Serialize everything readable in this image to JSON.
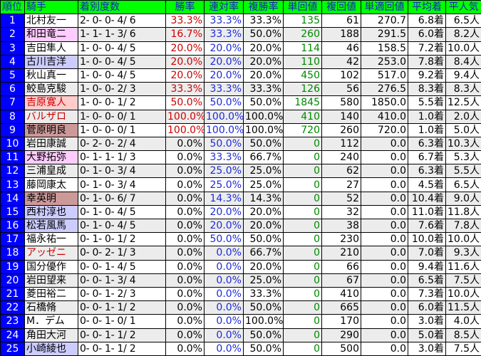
{
  "headers": [
    "順位",
    "騎手",
    "着別度数",
    "勝率",
    "連対率",
    "複勝率",
    "単回値",
    "複回値",
    "単適回値",
    "平均着",
    "平人気"
  ],
  "rows": [
    {
      "rank": "1",
      "name": "北村友一",
      "record": "2- 0- 0- 4/ 6",
      "win": "33.3%",
      "quin": "33.3%",
      "show": "33.3%",
      "tan": "135",
      "fuku": "61",
      "tekio": "270.7",
      "avg": "6.8着",
      "pop": "6.5人",
      "hl": ""
    },
    {
      "rank": "2",
      "name": "和田竜二",
      "record": "1- 1- 1- 3/ 6",
      "win": "16.7%",
      "quin": "33.3%",
      "show": "50.0%",
      "tan": "260",
      "fuku": "188",
      "tekio": "291.5",
      "avg": "6.0着",
      "pop": "8.2人",
      "hl": "pink"
    },
    {
      "rank": "3",
      "name": "吉田隼人",
      "record": "1- 0- 0- 4/ 5",
      "win": "20.0%",
      "quin": "20.0%",
      "show": "20.0%",
      "tan": "114",
      "fuku": "46",
      "tekio": "158.5",
      "avg": "7.2着",
      "pop": "10.0人",
      "hl": ""
    },
    {
      "rank": "4",
      "name": "古川吉洋",
      "record": "1- 0- 0- 4/ 5",
      "win": "20.0%",
      "quin": "20.0%",
      "show": "20.0%",
      "tan": "110",
      "fuku": "42",
      "tekio": "253.0",
      "avg": "7.8着",
      "pop": "8.4人",
      "hl": "lav"
    },
    {
      "rank": "5",
      "name": "秋山真一",
      "record": "1- 0- 0- 4/ 5",
      "win": "20.0%",
      "quin": "20.0%",
      "show": "20.0%",
      "tan": "450",
      "fuku": "102",
      "tekio": "517.0",
      "avg": "9.2着",
      "pop": "9.4人",
      "hl": ""
    },
    {
      "rank": "6",
      "name": "鮫島克駿",
      "record": "1- 0- 0- 2/ 3",
      "win": "33.3%",
      "quin": "33.3%",
      "show": "33.3%",
      "tan": "126",
      "fuku": "56",
      "tekio": "276.5",
      "avg": "8.3着",
      "pop": "8.3人",
      "hl": ""
    },
    {
      "rank": "7",
      "name": "吉原寛人",
      "record": "1- 0- 0- 1/ 2",
      "win": "50.0%",
      "quin": "50.0%",
      "show": "50.0%",
      "tan": "1845",
      "fuku": "580",
      "tekio": "1850.0",
      "avg": "5.5着",
      "pop": "12.5人",
      "hl": "salmon",
      "redname": true
    },
    {
      "rank": "8",
      "name": "バルザロ",
      "record": "1- 0- 0- 0/ 1",
      "win": "100.0%",
      "quin": "100.0%",
      "show": "100.0%",
      "tan": "410",
      "fuku": "140",
      "tekio": "410.0",
      "avg": "1.0着",
      "pop": "2.0人",
      "hl": "",
      "redname": true
    },
    {
      "rank": "9",
      "name": "菅原明良",
      "record": "1- 0- 0- 0/ 1",
      "win": "100.0%",
      "quin": "100.0%",
      "show": "100.0%",
      "tan": "720",
      "fuku": "260",
      "tekio": "720.0",
      "avg": "1.0着",
      "pop": "5.0人",
      "hl": "rose"
    },
    {
      "rank": "10",
      "name": "岩田康誠",
      "record": "0- 2- 0- 2/ 4",
      "win": "0.0%",
      "quin": "50.0%",
      "show": "50.0%",
      "tan": "0",
      "fuku": "112",
      "tekio": "0.0",
      "avg": "6.3着",
      "pop": "10.3人",
      "hl": ""
    },
    {
      "rank": "11",
      "name": "大野拓弥",
      "record": "0- 1- 1- 1/ 3",
      "win": "0.0%",
      "quin": "33.3%",
      "show": "66.7%",
      "tan": "0",
      "fuku": "240",
      "tekio": "0.0",
      "avg": "6.7着",
      "pop": "5.3人",
      "hl": "pink"
    },
    {
      "rank": "12",
      "name": "三浦皇成",
      "record": "0- 1- 0- 3/ 4",
      "win": "0.0%",
      "quin": "25.0%",
      "show": "25.0%",
      "tan": "0",
      "fuku": "62",
      "tekio": "0.0",
      "avg": "6.3着",
      "pop": "5.5人",
      "hl": ""
    },
    {
      "rank": "13",
      "name": "藤岡康太",
      "record": "0- 1- 0- 3/ 4",
      "win": "0.0%",
      "quin": "25.0%",
      "show": "25.0%",
      "tan": "0",
      "fuku": "27",
      "tekio": "0.0",
      "avg": "4.5着",
      "pop": "6.5人",
      "hl": ""
    },
    {
      "rank": "14",
      "name": "幸英明",
      "record": "0- 1- 0- 6/ 7",
      "win": "0.0%",
      "quin": "14.3%",
      "show": "14.3%",
      "tan": "0",
      "fuku": "52",
      "tekio": "0.0",
      "avg": "10.4着",
      "pop": "9.0人",
      "hl": "rose"
    },
    {
      "rank": "15",
      "name": "西村淳也",
      "record": "0- 1- 0- 4/ 5",
      "win": "0.0%",
      "quin": "20.0%",
      "show": "20.0%",
      "tan": "0",
      "fuku": "32",
      "tekio": "0.0",
      "avg": "11.0着",
      "pop": "11.8人",
      "hl": "lav"
    },
    {
      "rank": "16",
      "name": "松若風馬",
      "record": "0- 1- 0- 4/ 5",
      "win": "0.0%",
      "quin": "20.0%",
      "show": "20.0%",
      "tan": "0",
      "fuku": "38",
      "tekio": "0.0",
      "avg": "7.6着",
      "pop": "7.8人",
      "hl": "lav"
    },
    {
      "rank": "17",
      "name": "福永祐一",
      "record": "0- 1- 0- 1/ 2",
      "win": "0.0%",
      "quin": "50.0%",
      "show": "50.0%",
      "tan": "0",
      "fuku": "230",
      "tekio": "0.0",
      "avg": "10.0着",
      "pop": "10.0人",
      "hl": ""
    },
    {
      "rank": "18",
      "name": "アッゼニ",
      "record": "0- 0- 2- 1/ 3",
      "win": "0.0%",
      "quin": "0.0%",
      "show": "66.7%",
      "tan": "0",
      "fuku": "210",
      "tekio": "0.0",
      "avg": "7.0着",
      "pop": "9.3人",
      "hl": "",
      "redname": true
    },
    {
      "rank": "19",
      "name": "国分優作",
      "record": "0- 0- 1- 4/ 5",
      "win": "0.0%",
      "quin": "0.0%",
      "show": "20.0%",
      "tan": "0",
      "fuku": "66",
      "tekio": "0.0",
      "avg": "9.4着",
      "pop": "11.6人",
      "hl": ""
    },
    {
      "rank": "20",
      "name": "岩田望来",
      "record": "0- 0- 1- 3/ 4",
      "win": "0.0%",
      "quin": "0.0%",
      "show": "25.0%",
      "tan": "0",
      "fuku": "67",
      "tekio": "0.0",
      "avg": "6.5着",
      "pop": "7.5人",
      "hl": ""
    },
    {
      "rank": "21",
      "name": "菱田裕二",
      "record": "0- 0- 1- 2/ 3",
      "win": "0.0%",
      "quin": "0.0%",
      "show": "33.3%",
      "tan": "0",
      "fuku": "410",
      "tekio": "0.0",
      "avg": "7.3着",
      "pop": "10.0人",
      "hl": ""
    },
    {
      "rank": "22",
      "name": "石橋脩",
      "record": "0- 0- 1- 1/ 2",
      "win": "0.0%",
      "quin": "0.0%",
      "show": "50.0%",
      "tan": "0",
      "fuku": "665",
      "tekio": "0.0",
      "avg": "6.0着",
      "pop": "11.5人",
      "hl": ""
    },
    {
      "rank": "23",
      "name": "M．デム",
      "record": "0- 0- 1- 0/ 1",
      "win": "0.0%",
      "quin": "0.0%",
      "show": "100.0%",
      "tan": "0",
      "fuku": "170",
      "tekio": "0.0",
      "avg": "3.0着",
      "pop": "4.0人",
      "hl": ""
    },
    {
      "rank": "24",
      "name": "角田大河",
      "record": "0- 0- 1- 1/ 2",
      "win": "0.0%",
      "quin": "0.0%",
      "show": "50.0%",
      "tan": "0",
      "fuku": "290",
      "tekio": "0.0",
      "avg": "5.0着",
      "pop": "8.5人",
      "hl": ""
    },
    {
      "rank": "25",
      "name": "小崎綾也",
      "record": "0- 0- 1- 1/ 2",
      "win": "0.0%",
      "quin": "0.0%",
      "show": "50.0%",
      "tan": "0",
      "fuku": "500",
      "tekio": "0.0",
      "avg": "3.0着",
      "pop": "7.5人",
      "hl": "lav"
    }
  ]
}
